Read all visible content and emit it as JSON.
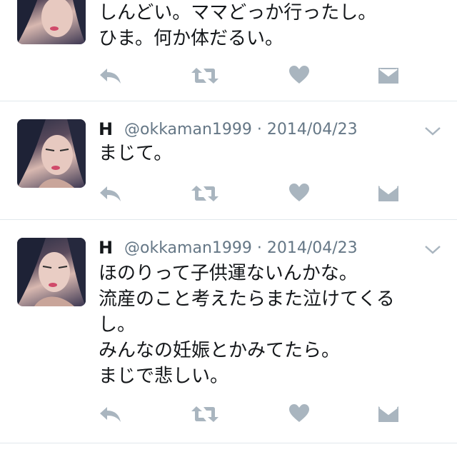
{
  "tweets": [
    {
      "name": "",
      "handle": "",
      "date": "",
      "lines": [
        "しんどい。ママどっか行ったし。",
        "ひま。何か体だるい。"
      ]
    },
    {
      "name": "H",
      "handle": "@okkaman1999",
      "date": "2014/04/23",
      "lines": [
        "まじて。"
      ]
    },
    {
      "name": "H",
      "handle": "@okkaman1999",
      "date": "2014/04/23",
      "lines": [
        "ほのりって子供運ないんかな。",
        "流産のこと考えたらまた泣けてくる",
        "し。",
        "みんなの妊娠とかみてたら。",
        "まじで悲しい。"
      ]
    }
  ],
  "separator": " · ",
  "colors": {
    "icon_gray": "#a9b5bf",
    "text_gray": "#657786",
    "divider": "#e1e8ed"
  },
  "icons": [
    "reply-icon",
    "retweet-icon",
    "like-icon",
    "direct-message-icon",
    "chevron-down-icon"
  ]
}
